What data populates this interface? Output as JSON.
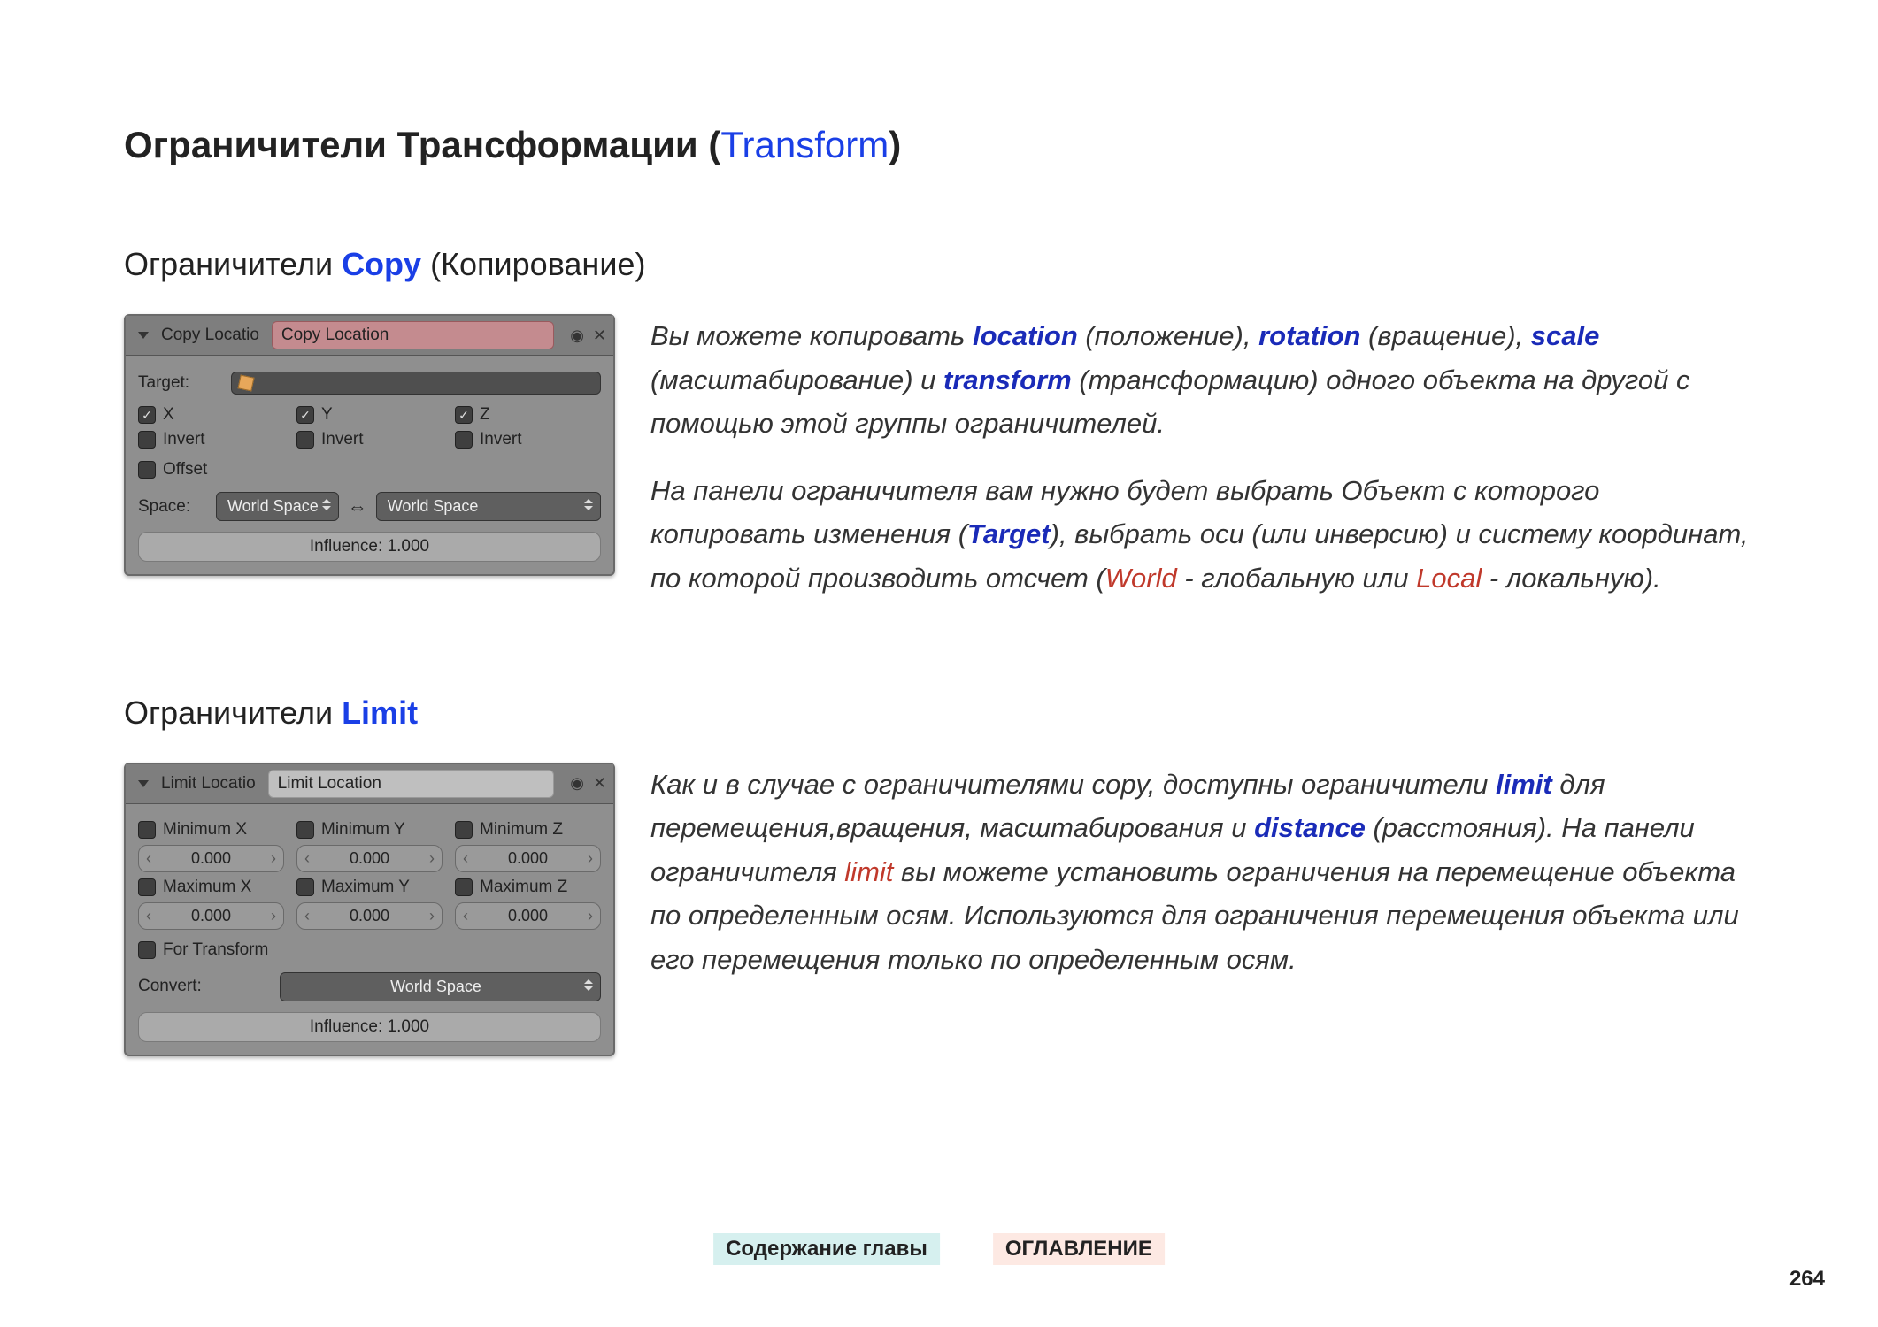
{
  "title": {
    "main": "Ограничители Трансформации (",
    "link": "Transform",
    "close": ")"
  },
  "copy": {
    "heading": {
      "a": "Ограничители ",
      "b": "Copy",
      "c": " (Копирование)"
    },
    "panel": {
      "header_short": "Copy Locatio",
      "header_name": "Copy Location",
      "target_label": "Target:",
      "axes": [
        "X",
        "Y",
        "Z"
      ],
      "invert": "Invert",
      "offset": "Offset",
      "space_label": "Space:",
      "space_a": "World Space",
      "space_b": "World Space",
      "influence": "Influence: 1.000"
    },
    "desc": {
      "p1a": "Вы можете копировать ",
      "kw1": "location",
      "p1b": " (положение), ",
      "kw2": "rotation",
      "p1c": " (вращение), ",
      "kw3": "scale",
      "p1d": " (масштабирование) и ",
      "kw4": "transform",
      "p1e": " (трансформацию) одного объекта на другой с помощью этой группы ограничителей.",
      "p2a": "На панели ограничителя вам нужно будет выбрать Объект с которого копировать изменения (",
      "kw5": "Target",
      "p2b": "), выбрать оси (или инверсию) и систему координат, по которой производить отсчет (",
      "kw6": "World",
      "p2c": " - глобальную или ",
      "kw7": "Local",
      "p2d": " - локальную)."
    }
  },
  "limit": {
    "heading": {
      "a": "Ограничители ",
      "b": "Limit"
    },
    "panel": {
      "header_short": "Limit Locatio",
      "header_name": "Limit Location",
      "min": [
        "Minimum X",
        "Minimum Y",
        "Minimum Z"
      ],
      "max": [
        "Maximum X",
        "Maximum Y",
        "Maximum Z"
      ],
      "val": "0.000",
      "for_transform": "For Transform",
      "convert_label": "Convert:",
      "convert_val": "World Space",
      "influence": "Influence: 1.000"
    },
    "desc": {
      "p1a": "Как и в случае с ограничителями copy, доступны ограничители ",
      "kw1": "limit",
      "p1b": " для перемещения,вращения, масштабирования и ",
      "kw2": "distance",
      "p1c": " (расстояния). На панели ограничителя ",
      "kw3": "limit",
      "p1d": " вы можете установить ограничения на перемещение объекта по определенным осям. Используются для ограничения перемещения объекта или его перемещения только по определенным осям."
    }
  },
  "footer": {
    "chapter": "Содержание главы",
    "toc": "ОГЛАВЛЕНИЕ",
    "page": "264"
  }
}
